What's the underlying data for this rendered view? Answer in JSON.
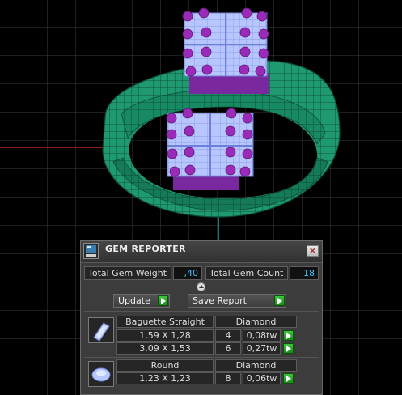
{
  "panel": {
    "title": "GEM REPORTER",
    "logo_icon": "gem-reporter-logo-icon",
    "close_icon": "close-icon",
    "total_weight_label": "Total Gem Weight",
    "total_weight_value": ",40",
    "total_count_label": "Total Gem Count",
    "total_count_value": "18",
    "update_label": "Update",
    "save_report_label": "Save Report"
  },
  "groups": [
    {
      "shape": "Baguette Straight",
      "material": "Diamond",
      "icon": "baguette-gem-icon",
      "rows": [
        {
          "size": "1,59 X 1,28",
          "count": "4",
          "weight": "0,08tw"
        },
        {
          "size": "3,09 X 1,53",
          "count": "6",
          "weight": "0,27tw"
        }
      ]
    },
    {
      "shape": "Round",
      "material": "Diamond",
      "icon": "round-gem-icon",
      "rows": [
        {
          "size": "1,23 X 1,23",
          "count": "8",
          "weight": "0,06tw"
        }
      ]
    }
  ],
  "colors": {
    "viewport_bg": "#000000",
    "grid": "#3c3c3c",
    "ring_band": "#1f9a70",
    "gem_blue": "#b8c6ff",
    "prong_purple": "#9a2bb8",
    "value_text": "#46c3ff",
    "go_button": "#2aa52a"
  }
}
